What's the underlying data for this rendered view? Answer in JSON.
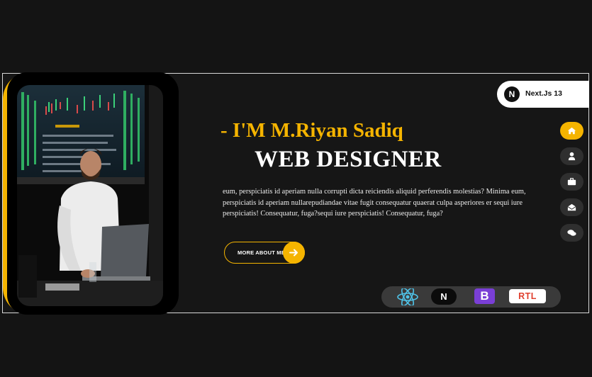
{
  "hero": {
    "intro": "- I'M M.Riyan Sadiq",
    "role": "WEB DESIGNER",
    "description": "eum, perspiciatis id aperiam nulla corrupti dicta reiciendis aliquid perferendis molestias? Minima eum, perspiciatis id aperiam nullarepudiandae vitae fugit consequatur quaerat culpa asperiores er sequi iure perspiciatis! Consequatur, fuga?sequi iure perspiciatis! Consequatur, fuga?",
    "button_label": "MORE ABOUT ME"
  },
  "framework_pill": {
    "logo": "N",
    "label": "Next.Js 13"
  },
  "side_nav": [
    {
      "icon": "home-icon",
      "active": true
    },
    {
      "icon": "user-icon",
      "active": false
    },
    {
      "icon": "briefcase-icon",
      "active": false
    },
    {
      "icon": "envelope-icon",
      "active": false
    },
    {
      "icon": "chat-icon",
      "active": false
    }
  ],
  "tech_bar": {
    "items": [
      {
        "icon": "react-icon"
      },
      {
        "icon": "nextjs-icon",
        "text": "N"
      },
      {
        "icon": "bootstrap-icon",
        "text": "B"
      },
      {
        "icon": "rtl-icon",
        "text": "RTL"
      }
    ]
  },
  "colors": {
    "accent": "#f5b400",
    "background": "#141414"
  }
}
